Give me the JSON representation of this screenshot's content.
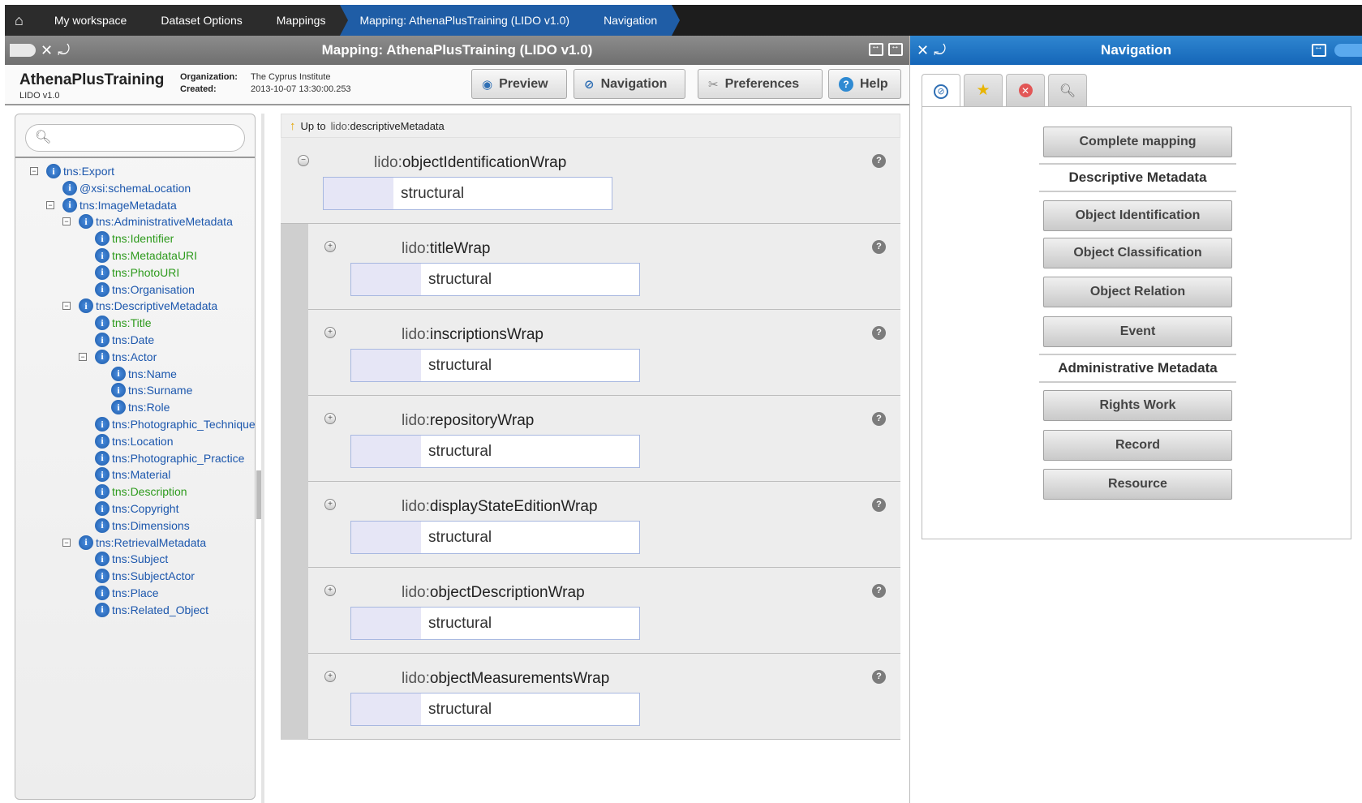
{
  "breadcrumb": {
    "home_icon": "home-icon",
    "items": [
      "My workspace",
      "Dataset Options",
      "Mappings",
      "Mapping: AthenaPlusTraining (LIDO v1.0)",
      "Navigation"
    ]
  },
  "left_panel": {
    "title": "Mapping: AthenaPlusTraining (LIDO v1.0)",
    "project_name": "AthenaPlusTraining",
    "schema": "LIDO v1.0",
    "organization_label": "Organization:",
    "organization_value": "The Cyprus Institute",
    "created_label": "Created:",
    "created_value": "2013-10-07 13:30:00.253",
    "toolbar": {
      "preview": "Preview",
      "navigation": "Navigation",
      "preferences": "Preferences",
      "help": "Help"
    }
  },
  "tree": {
    "search_placeholder": "",
    "nodes": [
      {
        "label": "tns:Export",
        "toggle": "−",
        "color": "blue"
      },
      {
        "label": "@xsi:schemaLocation",
        "toggle": "",
        "color": "blue"
      },
      {
        "label": "tns:ImageMetadata",
        "toggle": "−",
        "color": "blue"
      },
      {
        "label": "tns:AdministrativeMetadata",
        "toggle": "−",
        "color": "blue"
      },
      {
        "label": "tns:Identifier",
        "toggle": "",
        "color": "green"
      },
      {
        "label": "tns:MetadataURI",
        "toggle": "",
        "color": "green"
      },
      {
        "label": "tns:PhotoURI",
        "toggle": "",
        "color": "green"
      },
      {
        "label": "tns:Organisation",
        "toggle": "",
        "color": "blue"
      },
      {
        "label": "tns:DescriptiveMetadata",
        "toggle": "−",
        "color": "blue"
      },
      {
        "label": "tns:Title",
        "toggle": "",
        "color": "green"
      },
      {
        "label": "tns:Date",
        "toggle": "",
        "color": "blue"
      },
      {
        "label": "tns:Actor",
        "toggle": "−",
        "color": "blue"
      },
      {
        "label": "tns:Name",
        "toggle": "",
        "color": "blue"
      },
      {
        "label": "tns:Surname",
        "toggle": "",
        "color": "blue"
      },
      {
        "label": "tns:Role",
        "toggle": "",
        "color": "blue"
      },
      {
        "label": "tns:Photographic_Technique",
        "toggle": "",
        "color": "blue"
      },
      {
        "label": "tns:Location",
        "toggle": "",
        "color": "blue"
      },
      {
        "label": "tns:Photographic_Practice",
        "toggle": "",
        "color": "blue"
      },
      {
        "label": "tns:Material",
        "toggle": "",
        "color": "blue"
      },
      {
        "label": "tns:Description",
        "toggle": "",
        "color": "green"
      },
      {
        "label": "tns:Copyright",
        "toggle": "",
        "color": "blue"
      },
      {
        "label": "tns:Dimensions",
        "toggle": "",
        "color": "blue"
      },
      {
        "label": "tns:RetrievalMetadata",
        "toggle": "−",
        "color": "blue"
      },
      {
        "label": "tns:Subject",
        "toggle": "",
        "color": "blue"
      },
      {
        "label": "tns:SubjectActor",
        "toggle": "",
        "color": "blue"
      },
      {
        "label": "tns:Place",
        "toggle": "",
        "color": "blue"
      },
      {
        "label": "tns:Related_Object",
        "toggle": "",
        "color": "blue"
      }
    ]
  },
  "mapping": {
    "up_prefix": "Up to",
    "up_ns": "lido:",
    "up_target": "descriptiveMetadata",
    "parent": {
      "ns": "lido:",
      "name": "objectIdentificationWrap",
      "type": "structural",
      "toggle": "−"
    },
    "children": [
      {
        "ns": "lido:",
        "name": "titleWrap",
        "type": "structural",
        "toggle": "+"
      },
      {
        "ns": "lido:",
        "name": "inscriptionsWrap",
        "type": "structural",
        "toggle": "+"
      },
      {
        "ns": "lido:",
        "name": "repositoryWrap",
        "type": "structural",
        "toggle": "+"
      },
      {
        "ns": "lido:",
        "name": "displayStateEditionWrap",
        "type": "structural",
        "toggle": "+"
      },
      {
        "ns": "lido:",
        "name": "objectDescriptionWrap",
        "type": "structural",
        "toggle": "+"
      },
      {
        "ns": "lido:",
        "name": "objectMeasurementsWrap",
        "type": "structural",
        "toggle": "+"
      }
    ],
    "help_glyph": "?"
  },
  "right_panel": {
    "title": "Navigation",
    "tabs": [
      "compass-icon",
      "star-icon",
      "x-circle-icon",
      "magnifier-icon"
    ],
    "buttons": {
      "complete": "Complete mapping",
      "section_descriptive": "Descriptive Metadata",
      "object_identification": "Object Identification",
      "object_classification": "Object Classification",
      "object_relation": "Object Relation",
      "event": "Event",
      "section_administrative": "Administrative Metadata",
      "rights_work": "Rights Work",
      "record": "Record",
      "resource": "Resource"
    }
  },
  "colors": {
    "breadcrumb_active": "#1f5da6",
    "nav_header": "#1566b8",
    "tree_blue": "#1c57ad",
    "tree_green": "#2d9a1c"
  }
}
